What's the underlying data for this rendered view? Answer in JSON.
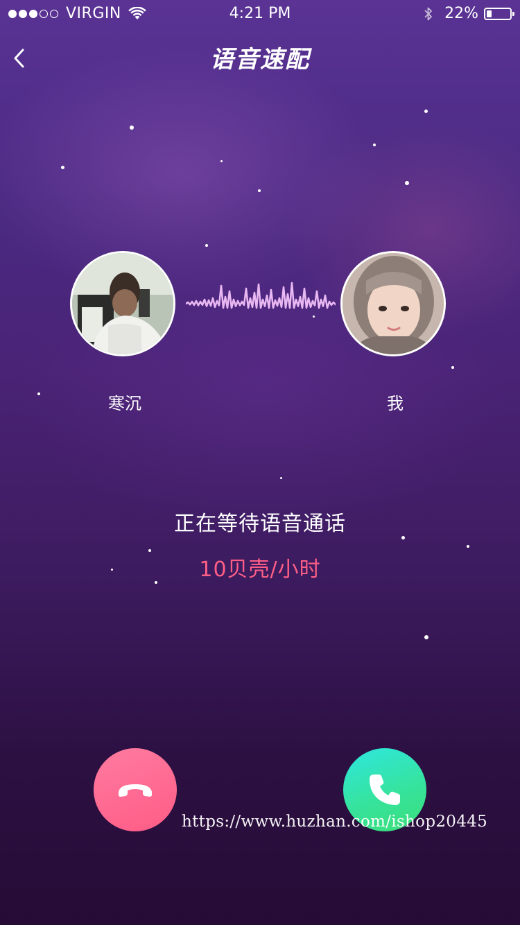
{
  "status_bar": {
    "carrier": "VIRGIN",
    "signal_full_dots": 3,
    "signal_total_dots": 5,
    "time": "4:21 PM",
    "battery_percent_text": "22%",
    "battery_level": 0.22,
    "icons": [
      "wifi-icon",
      "bluetooth-icon",
      "battery-icon"
    ]
  },
  "nav": {
    "back_icon": "chevron-left-icon",
    "title": "语音速配"
  },
  "caller": {
    "name": "寒沉",
    "avatar_icon": "avatar-photo"
  },
  "me": {
    "name": "我",
    "avatar_icon": "avatar-photo"
  },
  "waveform_icon": "audio-wave-icon",
  "call": {
    "status": "正在等待语音通话",
    "price": "10贝壳/小时"
  },
  "actions": {
    "hangup_icon": "phone-hangup-icon",
    "accept_icon": "phone-accept-icon"
  },
  "watermark": "https://www.huzhan.com/ishop20445",
  "colors": {
    "background_top": "#5a3394",
    "background_bottom": "#260b36",
    "price": "#ff5f86",
    "hangup": "#ff5c86",
    "accept": "#36e39e",
    "waveform": "#e9b8f2"
  }
}
